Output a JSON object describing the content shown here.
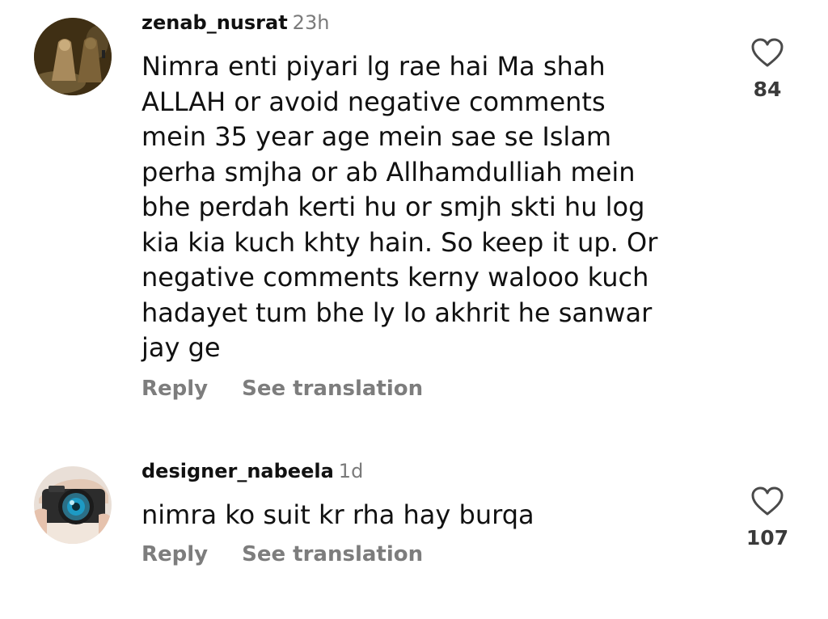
{
  "comments": [
    {
      "username": "zenab_nusrat",
      "time": "23h",
      "lines": [
        "Nimra enti piyari lg rae hai Ma shah",
        "ALLAH or avoid negative comments",
        "mein 35 year age mein sae se Islam",
        "perha smjha or ab Allhamdulliah mein",
        "bhe perdah kerti hu or smjh skti hu log",
        "kia kia kuch khty hain. So keep it up. Or",
        "negative comments kerny walooo kuch",
        "hadayet tum bhe ly lo akhrit he sanwar",
        "jay ge"
      ],
      "reply_label": "Reply",
      "translate_label": "See translation",
      "like_icon": "heart-outline-icon",
      "like_count": "84"
    },
    {
      "username": "designer_nabeela",
      "time": "1d",
      "lines": [
        "nimra ko suit kr rha hay burqa"
      ],
      "reply_label": "Reply",
      "translate_label": "See translation",
      "like_icon": "heart-outline-icon",
      "like_count": "107"
    }
  ],
  "colors": {
    "username": "#111111",
    "timestamp": "#7a7a7a",
    "action": "#7d7d7d",
    "like_count": "#3a3a3a"
  }
}
